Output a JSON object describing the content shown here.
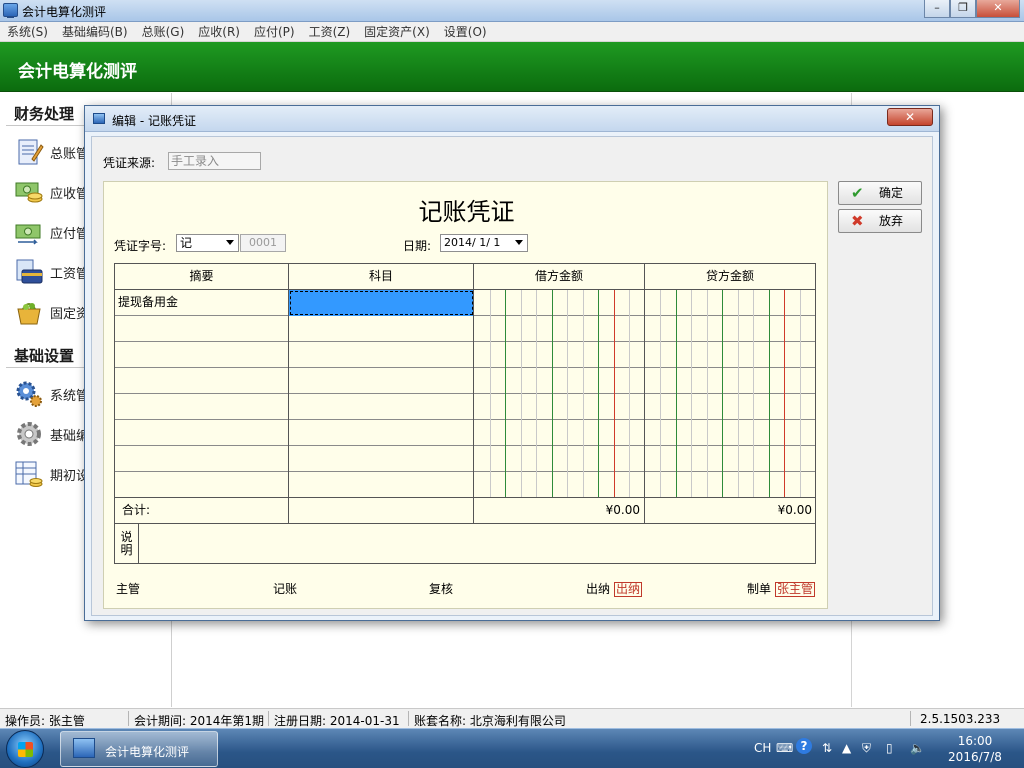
{
  "window": {
    "title": "会计电算化测评"
  },
  "menu": [
    "系统(S)",
    "基础编码(B)",
    "总账(G)",
    "应收(R)",
    "应付(P)",
    "工资(Z)",
    "固定资产(X)",
    "设置(O)"
  ],
  "header": {
    "title": "会计电算化测评"
  },
  "sidebar": {
    "sections": [
      {
        "title": "财务处理",
        "items": [
          "总账管",
          "应收管",
          "应付管",
          "工资管",
          "固定资"
        ]
      },
      {
        "title": "基础设置",
        "items": [
          "系统管",
          "基础编",
          "期初设"
        ]
      }
    ]
  },
  "dialog": {
    "title": "编辑 - 记账凭证",
    "close_label": "✕",
    "source_label": "凭证来源:",
    "source_value": "手工录入",
    "voucher_title": "记账凭证",
    "word_label": "凭证字号:",
    "word_value": "记",
    "number_value": "0001",
    "date_label": "日期:",
    "date_value": "2014/ 1/ 1",
    "columns": [
      "摘要",
      "科目",
      "借方金额",
      "贷方金额"
    ],
    "rows": [
      {
        "summary": "提现备用金",
        "account": ""
      },
      {
        "summary": "",
        "account": ""
      },
      {
        "summary": "",
        "account": ""
      },
      {
        "summary": "",
        "account": ""
      },
      {
        "summary": "",
        "account": ""
      },
      {
        "summary": "",
        "account": ""
      },
      {
        "summary": "",
        "account": ""
      },
      {
        "summary": "",
        "account": ""
      }
    ],
    "total_label": "合计:",
    "debit_total": "¥0.00",
    "credit_total": "¥0.00",
    "remark_label": "说明",
    "signatures": {
      "supervisor_label": "主管",
      "bookkeeper_label": "记账",
      "reviewer_label": "复核",
      "cashier_label": "出纳",
      "cashier_stamp": "出纳",
      "maker_label": "制单",
      "maker_stamp": "张主管"
    },
    "confirm_label": "确定",
    "discard_label": "放弃"
  },
  "status": {
    "operator": "操作员: 张主管",
    "period": "会计期间: 2014年第1期",
    "register_date": "注册日期: 2014-01-31",
    "account_set": "账套名称: 北京海利有限公司",
    "version": "2.5.1503.233"
  },
  "taskbar": {
    "app_label": "会计电算化测评",
    "lang": "CH",
    "time": "16:00",
    "date": "2016/7/8"
  },
  "colors": {
    "header_green": "#0b6c0e",
    "selection_blue": "#3399ff",
    "stamp_red": "#c0392b"
  }
}
